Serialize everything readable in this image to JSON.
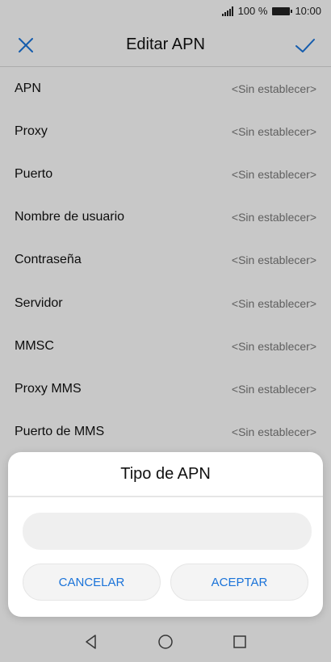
{
  "status_bar": {
    "battery_text": "100 %",
    "time": "10:00"
  },
  "app_bar": {
    "title": "Editar APN",
    "close_icon": "close-icon",
    "confirm_icon": "check-icon",
    "accent_color": "#1a73d9"
  },
  "apn_fields": [
    {
      "label": "APN",
      "value": "<Sin establecer>"
    },
    {
      "label": "Proxy",
      "value": "<Sin establecer>"
    },
    {
      "label": "Puerto",
      "value": "<Sin establecer>"
    },
    {
      "label": "Nombre de usuario",
      "value": "<Sin establecer>"
    },
    {
      "label": "Contraseña",
      "value": "<Sin establecer>"
    },
    {
      "label": "Servidor",
      "value": "<Sin establecer>"
    },
    {
      "label": "MMSC",
      "value": "<Sin establecer>"
    },
    {
      "label": "Proxy MMS",
      "value": "<Sin establecer>"
    },
    {
      "label": "Puerto de MMS",
      "value": "<Sin establecer>"
    }
  ],
  "dialog": {
    "title": "Tipo de APN",
    "input_value": "",
    "cancel_label": "CANCELAR",
    "accept_label": "ACEPTAR"
  },
  "nav_bar": {
    "icons": [
      "back-icon",
      "home-icon",
      "recents-icon"
    ]
  }
}
